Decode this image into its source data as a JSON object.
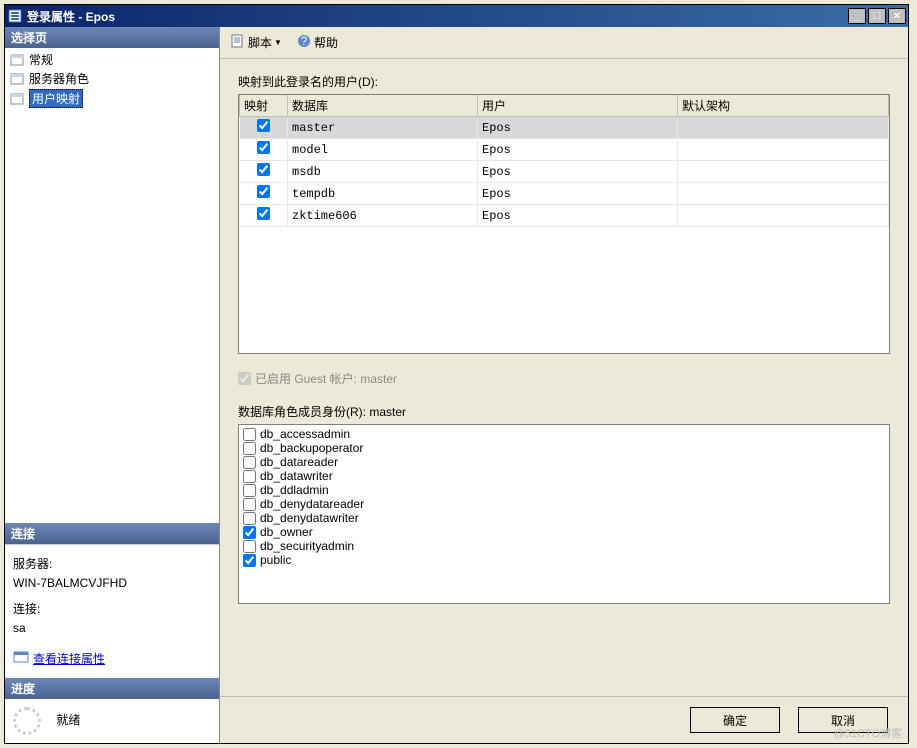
{
  "window": {
    "title": "登录属性 - Epos"
  },
  "sidebar": {
    "header": "选择页",
    "pages": [
      {
        "label": "常规",
        "selected": false
      },
      {
        "label": "服务器角色",
        "selected": false
      },
      {
        "label": "用户映射",
        "selected": true
      }
    ],
    "connection": {
      "header": "连接",
      "serverLabel": "服务器:",
      "serverValue": "WIN-7BALMCVJFHD",
      "connLabel": "连接:",
      "connValue": "sa",
      "linkText": "查看连接属性"
    },
    "progress": {
      "header": "进度",
      "status": "就绪"
    }
  },
  "toolbar": {
    "script": "脚本",
    "help": "帮助"
  },
  "main": {
    "mappingLabel": "映射到此登录名的用户(D):",
    "columns": {
      "map": "映射",
      "db": "数据库",
      "user": "用户",
      "schema": "默认架构"
    },
    "rows": [
      {
        "checked": true,
        "db": "master",
        "user": "Epos",
        "schema": "",
        "selected": true
      },
      {
        "checked": true,
        "db": "model",
        "user": "Epos",
        "schema": ""
      },
      {
        "checked": true,
        "db": "msdb",
        "user": "Epos",
        "schema": ""
      },
      {
        "checked": true,
        "db": "tempdb",
        "user": "Epos",
        "schema": ""
      },
      {
        "checked": true,
        "db": "zktime606",
        "user": "Epos",
        "schema": ""
      }
    ],
    "guestLabel": "已启用 Guest 帐户: master",
    "rolesLabel": "数据库角色成员身份(R): master",
    "roles": [
      {
        "name": "db_accessadmin",
        "checked": false
      },
      {
        "name": "db_backupoperator",
        "checked": false
      },
      {
        "name": "db_datareader",
        "checked": false
      },
      {
        "name": "db_datawriter",
        "checked": false
      },
      {
        "name": "db_ddladmin",
        "checked": false
      },
      {
        "name": "db_denydatareader",
        "checked": false
      },
      {
        "name": "db_denydatawriter",
        "checked": false
      },
      {
        "name": "db_owner",
        "checked": true
      },
      {
        "name": "db_securityadmin",
        "checked": false
      },
      {
        "name": "public",
        "checked": true
      }
    ]
  },
  "buttons": {
    "ok": "确定",
    "cancel": "取消"
  },
  "watermark": "@51CTO博客"
}
